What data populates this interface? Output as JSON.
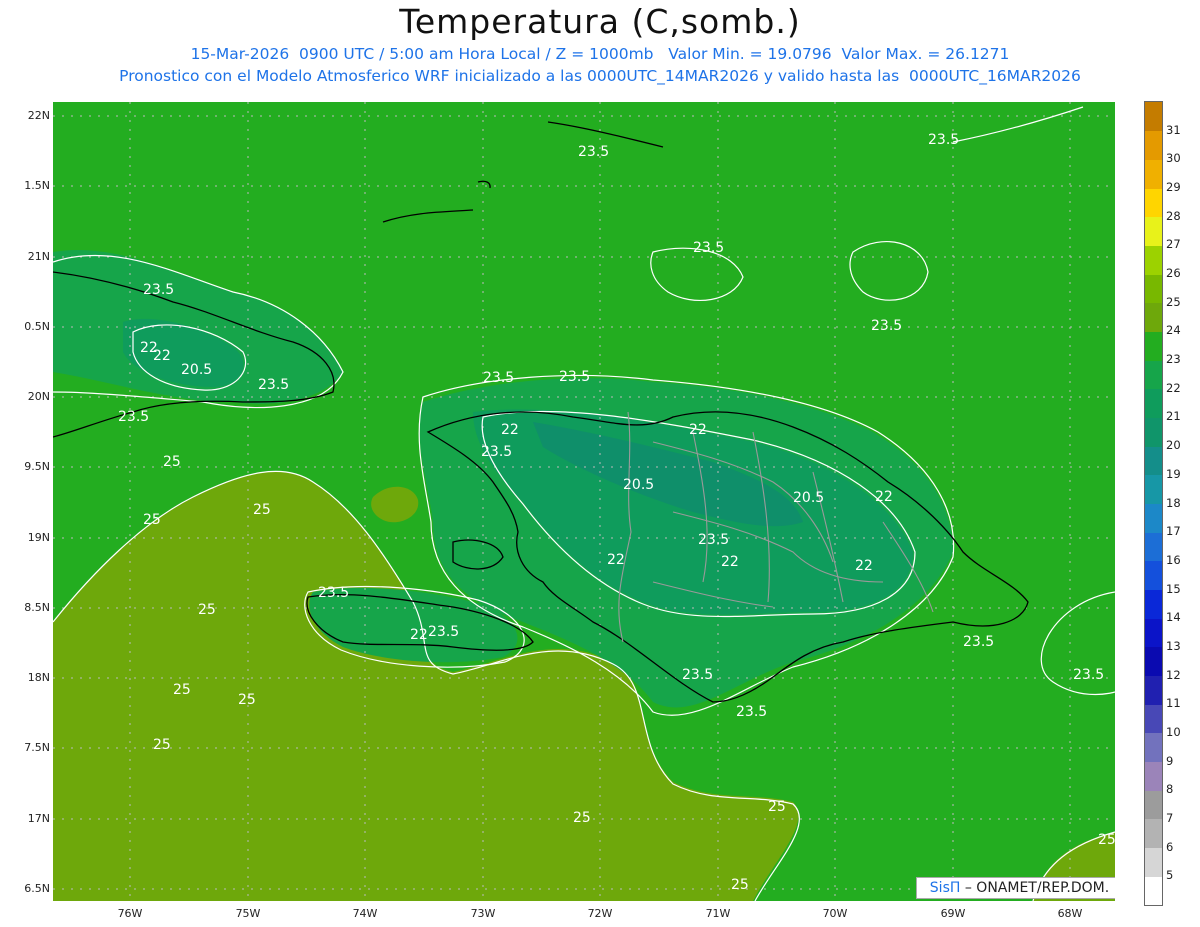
{
  "title": "Temperatura (C,somb.)",
  "subtitle_line1": "15-Mar-2026  0900 UTC / 5:00 am Hora Local / Z = 1000mb   Valor Min. = 19.0796  Valor Max. = 26.1271",
  "subtitle_line2": "Pronostico con el Modelo Atmosferico WRF inicializado a las 0000UTC_14MAR2026 y valido hasta las  0000UTC_16MAR2026",
  "credit": {
    "brand": "SisΠ",
    "text": " – ONAMET/REP.DOM."
  },
  "map": {
    "lat_labels": [
      "22N",
      "1.5N",
      "21N",
      "0.5N",
      "20N",
      "9.5N",
      "19N",
      "8.5N",
      "18N",
      "7.5N",
      "17N",
      "6.5N"
    ],
    "lon_labels": [
      "76W",
      "75W",
      "74W",
      "73W",
      "72W",
      "71W",
      "70W",
      "69W",
      "68W"
    ],
    "contour_labels": [
      "23.5",
      "23.5",
      "23.5",
      "22",
      "20.5",
      "22",
      "23.5",
      "23.5",
      "23.5",
      "23.5",
      "22",
      "23.5",
      "22",
      "20.5",
      "20.5",
      "23.5",
      "22",
      "23.5",
      "22",
      "22",
      "22",
      "23.5",
      "23.5",
      "23.5",
      "23.5",
      "23.5",
      "22",
      "23.5",
      "23.5",
      "25",
      "25",
      "25",
      "25",
      "25",
      "25",
      "25",
      "25",
      "25",
      "25",
      "25"
    ],
    "colors": {
      "field_24": "#23ad20",
      "field_25": "#6ea80b",
      "field_23": "#16a54a",
      "field_22": "#0f9c5c",
      "field_21": "#0f8f6a",
      "contour": "#ffffff",
      "coast": "#000000",
      "border": "#999999",
      "grid": "#bbbbbb"
    }
  },
  "colorbar": {
    "levels": [
      "5",
      "6",
      "7",
      "8",
      "9",
      "10",
      "11",
      "12",
      "13",
      "14",
      "15",
      "16",
      "17",
      "18",
      "19",
      "20",
      "21",
      "22",
      "23",
      "24",
      "25",
      "26",
      "27",
      "28",
      "29",
      "30",
      "31"
    ],
    "colors": [
      "#ffffff",
      "#d6d6d6",
      "#b3b3b3",
      "#9c9c9c",
      "#9b84b9",
      "#7272bd",
      "#4848b6",
      "#2020b0",
      "#0a0ab0",
      "#0b14c8",
      "#0a28d8",
      "#1450dc",
      "#1c6ed6",
      "#1c88c8",
      "#1797a6",
      "#148e8a",
      "#10956a",
      "#0f9c5c",
      "#16a54a",
      "#23ad20",
      "#6ea80b",
      "#78b800",
      "#9cd200",
      "#e8f21a",
      "#ffd500",
      "#f0b000",
      "#e49a00",
      "#c47c00"
    ]
  }
}
